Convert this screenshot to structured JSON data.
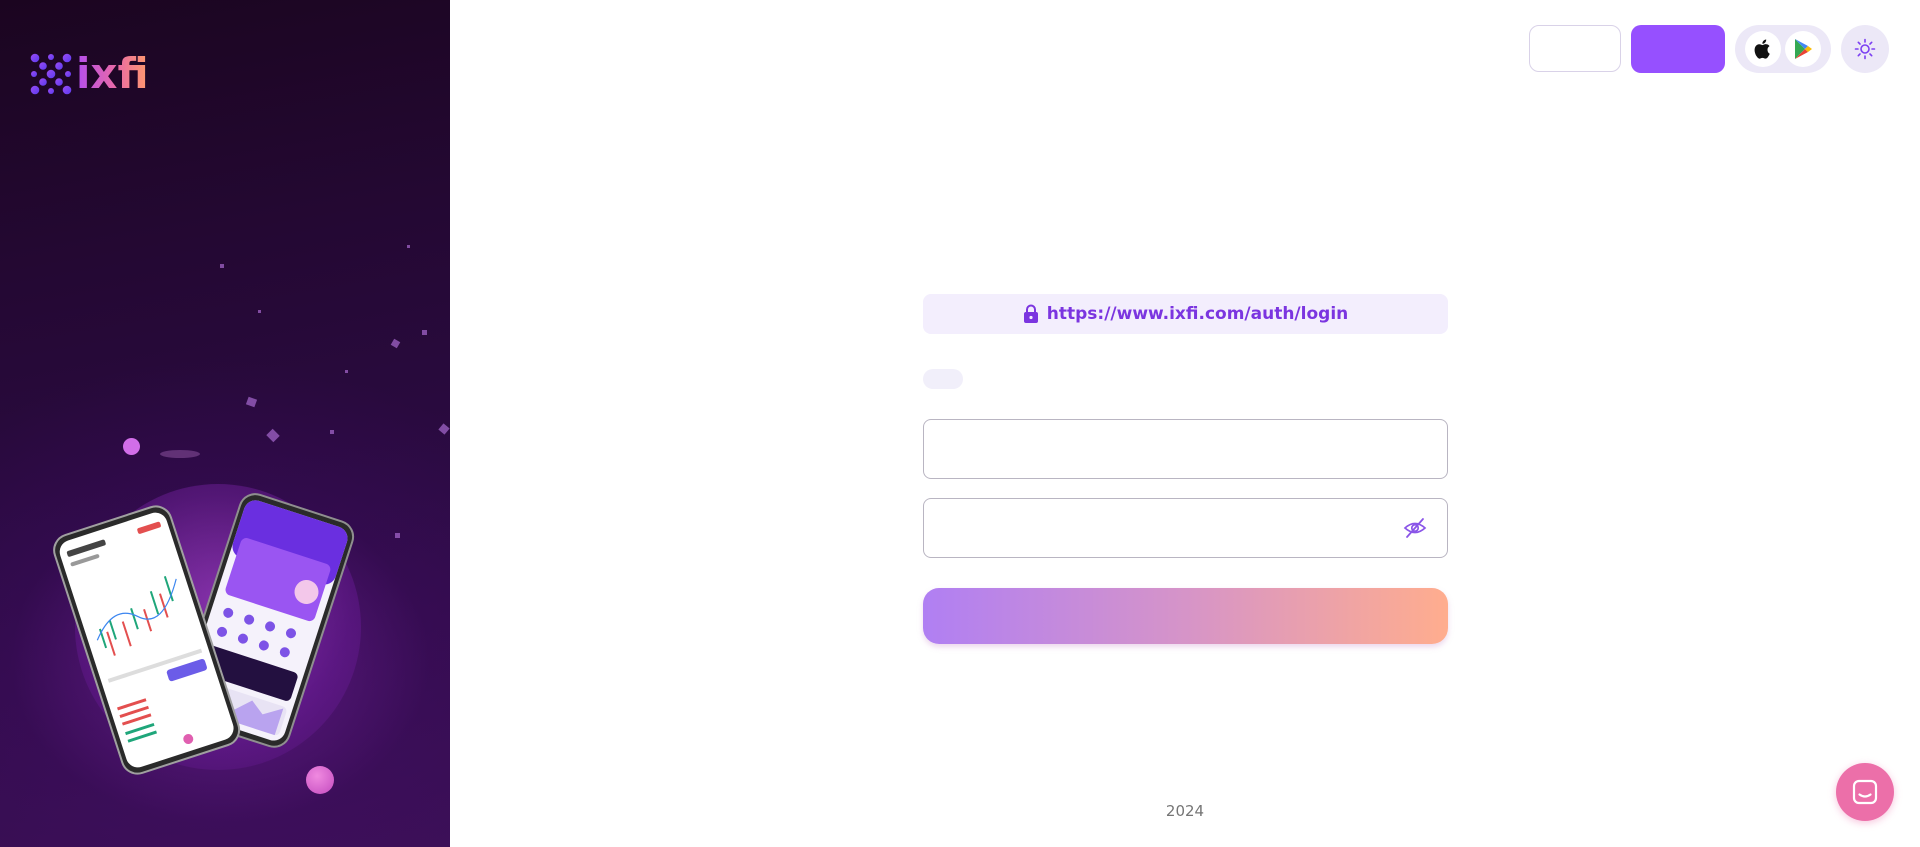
{
  "brand": {
    "name": "ixfi"
  },
  "header": {
    "login_label": "",
    "signup_label": "",
    "store_icons": [
      "apple-icon",
      "google-play-icon"
    ],
    "theme_icon": "sun-icon"
  },
  "login": {
    "url": "https://www.ixfi.com/auth/login",
    "email_placeholder": "",
    "password_placeholder": "",
    "submit_label": ""
  },
  "footer": {
    "text": "2024"
  },
  "colors": {
    "accent": "#9650ff",
    "url_text": "#7b35e0",
    "gradient_start": "#b07ff3",
    "gradient_end": "#ffad8e",
    "chat_button": "#ec6fa9"
  }
}
